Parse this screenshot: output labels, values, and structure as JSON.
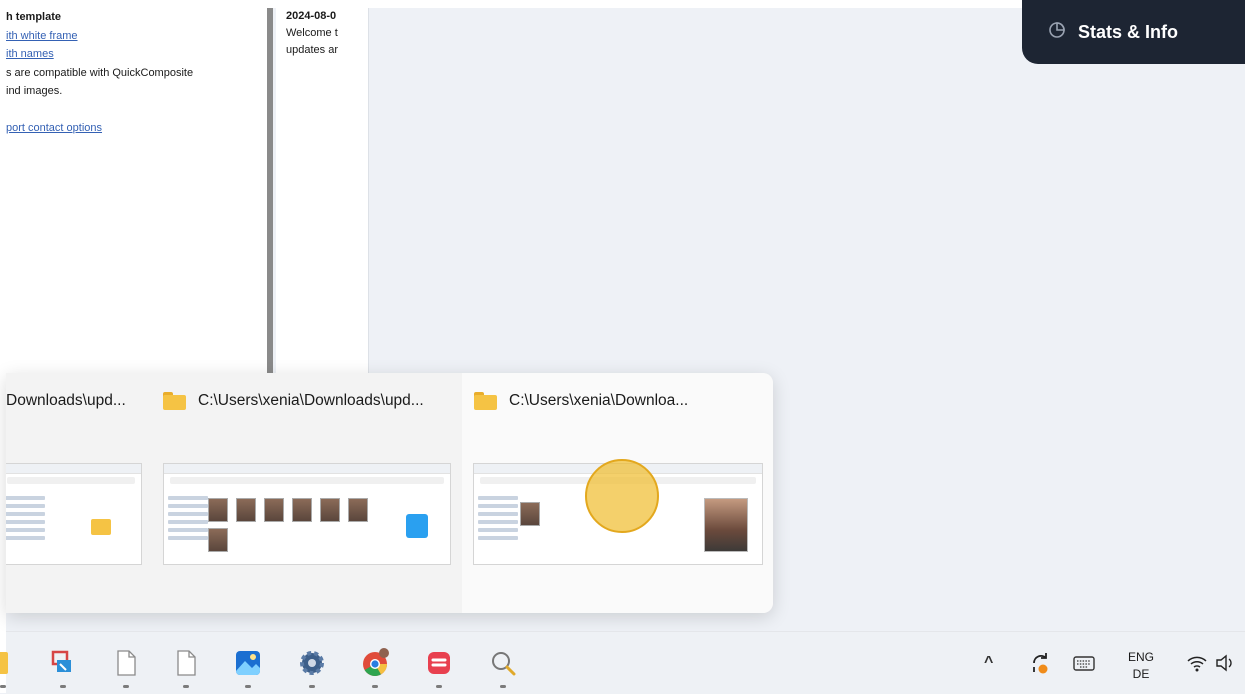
{
  "doc_left": {
    "lines": [
      {
        "text": "h template",
        "style": "bold"
      },
      {
        "text": "ith white frame",
        "style": "link"
      },
      {
        "text": "ith names",
        "style": "link"
      },
      {
        "text": "s are compatible with QuickComposite",
        "style": "plain"
      },
      {
        "text": "ind images.",
        "style": "plain"
      },
      {
        "text": "",
        "style": "gap"
      },
      {
        "text": "port contact options",
        "style": "link"
      }
    ]
  },
  "doc_mid": {
    "date": "2024-08-0",
    "line1": "Welcome t",
    "line2": "updates ar"
  },
  "stats_button": {
    "label": "Stats & Info",
    "icon": "pie-chart-icon"
  },
  "task_preview": {
    "windows": [
      {
        "title": "Downloads\\upd..."
      },
      {
        "title": "C:\\Users\\xenia\\Downloads\\upd..."
      },
      {
        "title": "C:\\Users\\xenia\\Downloa..."
      }
    ],
    "close_glyph": "✕"
  },
  "taskbar": {
    "apps": [
      "file-explorer-icon",
      "snipping-tool-icon",
      "document-icon",
      "document-icon",
      "photos-icon",
      "settings-icon",
      "chrome-icon",
      "app-icon",
      "search-magnifier-icon"
    ],
    "tray": {
      "lang_top": "ENG",
      "lang_bottom": "DE",
      "chevron": "^"
    }
  },
  "colors": {
    "accent_dark": "#1d2533",
    "highlight": "#f0be32",
    "link": "#3461b4"
  }
}
